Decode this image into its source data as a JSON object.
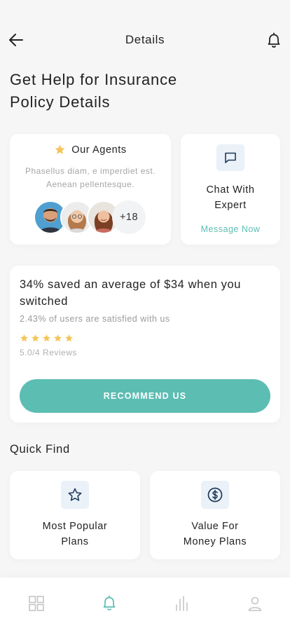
{
  "header": {
    "title": "Details",
    "back_icon": "arrow-left-icon",
    "notification_icon": "bell-icon"
  },
  "page": {
    "title_line1": "Get Help for Insurance",
    "title_line2": "Policy Details"
  },
  "agents": {
    "title": "Our Agents",
    "icon": "star-icon",
    "description": "Phasellus  diam, e imperdiet est. Aenean pellentesque.",
    "more_count": "+18"
  },
  "chat": {
    "icon": "chat-icon",
    "title_line1": "Chat With",
    "title_line2": "Expert",
    "link": "Message Now"
  },
  "stats": {
    "headline": "34% saved an average of $34 when you switched",
    "subtext": "2.43% of users are satisfied with us",
    "rating_stars": 5,
    "reviews": "5.0/4 Reviews",
    "button_label": "RECOMMEND US"
  },
  "quick_find": {
    "title": "Quick Find",
    "items": [
      {
        "label": "Most Popular\nPlans",
        "icon": "star-outline-icon"
      },
      {
        "label": "Value For\nMoney Plans",
        "icon": "dollar-circle-icon"
      }
    ]
  },
  "bottom_nav": {
    "items": [
      {
        "icon": "grid-icon",
        "active": false
      },
      {
        "icon": "bell-icon",
        "active": true
      },
      {
        "icon": "bar-chart-icon",
        "active": false
      },
      {
        "icon": "profile-icon",
        "active": false
      }
    ]
  },
  "colors": {
    "accent": "#5cbdb3",
    "star": "#f5c559",
    "icon_bg": "#eaf1f8",
    "icon_dark": "#1f3a5a",
    "background": "#f6f6f6"
  }
}
